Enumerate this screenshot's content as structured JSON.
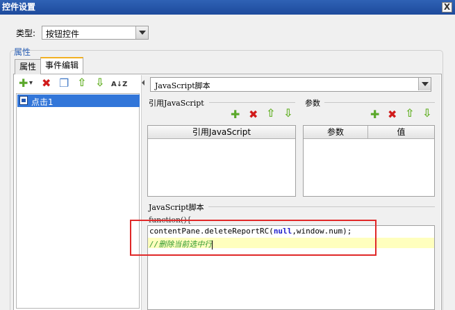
{
  "window": {
    "title": "控件设置",
    "close_glyph": "X"
  },
  "type_field": {
    "label": "类型:",
    "value": "按钮控件"
  },
  "group": {
    "title": "属性"
  },
  "tabs": [
    {
      "label": "属性"
    },
    {
      "label": "事件编辑"
    }
  ],
  "event_list": {
    "items": [
      {
        "label": "点击1"
      }
    ]
  },
  "left_toolbar": {
    "plus": "✚",
    "plus_arrow": "▾",
    "remove": "✖",
    "copy": "❐",
    "up": "⇧",
    "down": "⇩",
    "sort": "A↓Z"
  },
  "script_type": {
    "value": "JavaScript脚本"
  },
  "ref_js": {
    "section_label": "引用JavaScript",
    "column": "引用JavaScript",
    "toolbar": {
      "plus": "✚",
      "remove": "✖",
      "up": "⇧",
      "down": "⇩"
    }
  },
  "params": {
    "section_label": "参数",
    "columns": [
      "参数",
      "值"
    ],
    "toolbar": {
      "plus": "✚",
      "remove": "✖",
      "up": "⇧",
      "down": "⇩"
    }
  },
  "script": {
    "section_label": "JavaScript脚本",
    "header_line": "function(){",
    "line1_prefix": "contentPane.deleteReportRC(",
    "line1_keyword": "null",
    "line1_suffix": ",window.num);",
    "line2_comment": "//删除当前选中行"
  },
  "colors": {
    "title_bar": "#2f62b5",
    "selection": "#3276d9",
    "highlight_box": "#e02828",
    "comment": "#339933",
    "keyword": "#2020cc"
  }
}
